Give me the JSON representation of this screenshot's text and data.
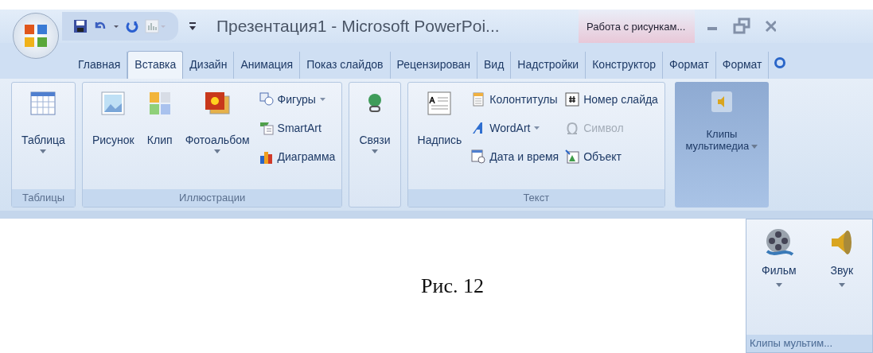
{
  "window": {
    "title": "Презентация1 - Microsoft PowerPoi...",
    "contextual_header": "Работа с рисункам..."
  },
  "tabs": [
    {
      "label": "Главная",
      "selected": false
    },
    {
      "label": "Вставка",
      "selected": true
    },
    {
      "label": "Дизайн",
      "selected": false
    },
    {
      "label": "Анимация",
      "selected": false
    },
    {
      "label": "Показ слайдов",
      "selected": false
    },
    {
      "label": "Рецензирован",
      "selected": false
    },
    {
      "label": "Вид",
      "selected": false
    },
    {
      "label": "Надстройки",
      "selected": false
    },
    {
      "label": "Конструктор",
      "selected": false
    },
    {
      "label": "Формат",
      "selected": false
    },
    {
      "label": "Формат",
      "selected": false
    }
  ],
  "groups": [
    {
      "label": "Таблицы",
      "items": [
        {
          "kind": "large",
          "label": "Таблица",
          "dropdown": true
        }
      ]
    },
    {
      "label": "Иллюстрации",
      "items": [
        {
          "kind": "large",
          "label": "Рисунок",
          "dropdown": false
        },
        {
          "kind": "large",
          "label": "Клип",
          "dropdown": false
        },
        {
          "kind": "large",
          "label": "Фотоальбом",
          "dropdown": true
        },
        {
          "kind": "small",
          "label": "Фигуры",
          "dropdown": true,
          "disabled": false
        },
        {
          "kind": "small",
          "label": "SmartArt",
          "dropdown": false,
          "disabled": false
        },
        {
          "kind": "small",
          "label": "Диаграмма",
          "dropdown": false,
          "disabled": false
        }
      ]
    },
    {
      "items": [
        {
          "kind": "large",
          "label": "Связи",
          "dropdown": true
        }
      ]
    },
    {
      "label": "Текст",
      "items": [
        {
          "kind": "large",
          "label": "Надпись",
          "dropdown": false
        },
        {
          "kind": "small",
          "label": "Колонтитулы",
          "dropdown": false,
          "disabled": false
        },
        {
          "kind": "small",
          "label": "WordArt",
          "dropdown": true,
          "disabled": false
        },
        {
          "kind": "small",
          "label": "Дата и время",
          "dropdown": false,
          "disabled": false
        },
        {
          "kind": "small",
          "label": "Номер слайда",
          "dropdown": false,
          "disabled": false
        },
        {
          "kind": "small",
          "label": "Символ",
          "dropdown": false,
          "disabled": true
        },
        {
          "kind": "small",
          "label": "Объект",
          "dropdown": false,
          "disabled": false
        }
      ]
    },
    {
      "kind": "collapsed",
      "label": "Клипы мультимедиа",
      "pressed": true,
      "dropdown": true
    }
  ],
  "popup": {
    "items": [
      {
        "label": "Фильм",
        "dropdown": true
      },
      {
        "label": "Звук",
        "dropdown": true
      }
    ],
    "label": "Клипы мультим..."
  },
  "caption": "Рис. 12"
}
